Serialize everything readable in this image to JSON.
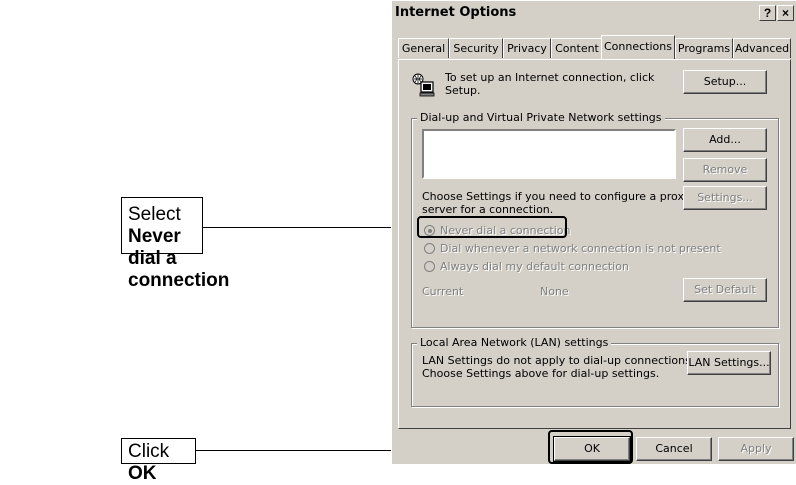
{
  "callouts": {
    "never_dial_prefix": "Select ",
    "never_dial_bold": "Never dial a connection",
    "ok_prefix": "Click ",
    "ok_bold": "OK"
  },
  "dialog": {
    "title": "Internet Options",
    "help_glyph": "?",
    "close_glyph": "×",
    "tabs": [
      "General",
      "Security",
      "Privacy",
      "Content",
      "Connections",
      "Programs",
      "Advanced"
    ],
    "active_tab": "Connections",
    "setup_text_line1": "To set up an Internet connection, click",
    "setup_text_line2": "Setup.",
    "setup_button": "Setup...",
    "dialup_group_label": "Dial-up and Virtual Private Network settings",
    "add_button": "Add...",
    "remove_button": "Remove",
    "settings_text_line1": "Choose Settings if you need to configure a proxy",
    "settings_text_line2": "server for a connection.",
    "settings_button": "Settings...",
    "radio_options": [
      "Never dial a connection",
      "Dial whenever a network connection is not present",
      "Always dial my default connection"
    ],
    "selected_radio": "Never dial a connection",
    "current_label": "Current",
    "current_value": "None",
    "set_default_button": "Set Default",
    "lan_group_label": "Local Area Network (LAN) settings",
    "lan_text_line1": "LAN Settings do not apply to dial-up connections.",
    "lan_text_line2": "Choose Settings above for dial-up settings.",
    "lan_button": "LAN Settings...",
    "ok_button": "OK",
    "cancel_button": "Cancel",
    "apply_button": "Apply"
  },
  "icons": {
    "connection": "network-computer-icon"
  }
}
